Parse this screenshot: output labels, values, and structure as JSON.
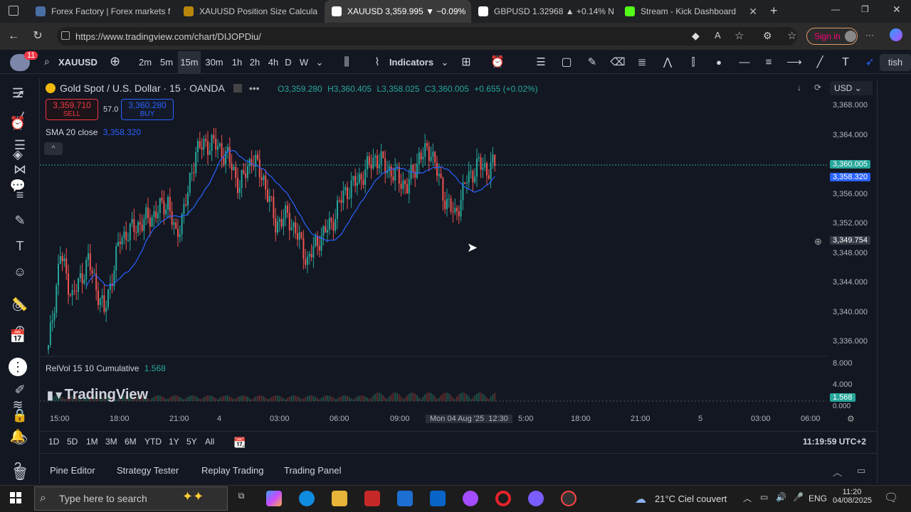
{
  "browser": {
    "tabs": [
      {
        "label": "Forex Factory | Forex markets f"
      },
      {
        "label": "XAUUSD Position Size Calcula"
      },
      {
        "label": "XAUUSD 3,359.995 ▼ −0.09%"
      },
      {
        "label": "GBPUSD 1.32968 ▲ +0.14% N"
      },
      {
        "label": "Stream - Kick Dashboard"
      }
    ],
    "url": "https://www.tradingview.com/chart/DIJOPDiu/",
    "signin": "Sign in"
  },
  "toolbar": {
    "notification_count": "11",
    "symbol": "XAUUSD",
    "intervals": [
      "2m",
      "5m",
      "15m",
      "30m",
      "1h",
      "2h",
      "4h",
      "D",
      "W"
    ],
    "selected_interval": "15m",
    "indicators": "Indicators",
    "publish": "tish"
  },
  "chart": {
    "title": "Gold Spot / U.S. Dollar · 15 · OANDA",
    "ohlc": {
      "o": "O3,359.280",
      "h": "H3,360.405",
      "l": "L3,358.025",
      "c": "C3,360.005",
      "chg": "+0.655 (+0.02%)"
    },
    "sell": {
      "price": "3,359.710",
      "label": "SELL"
    },
    "spread": "57.0",
    "buy": {
      "price": "3,360.280",
      "label": "BUY"
    },
    "sma_label": "SMA 20 close",
    "sma_value": "3,358.320",
    "currency": "USD",
    "relvol_label": "RelVol 15 10 Cumulative",
    "relvol_value": "1.568",
    "logo": "TradingView",
    "price_labels": [
      "3,368.000",
      "3,364.000",
      "3,360.005",
      "3,358.320",
      "3,356.000",
      "3,352.000",
      "3,349.754",
      "3,348.000",
      "3,344.000",
      "3,340.000",
      "3,336.000",
      "8.000",
      "4.000",
      "1.568",
      "0.000"
    ],
    "time_labels": [
      "15:00",
      "18:00",
      "21:00",
      "4",
      "03:00",
      "06:00",
      "09:00",
      "Mon 04 Aug '25",
      "12:30",
      "5:00",
      "18:00",
      "21:00",
      "5",
      "03:00",
      "06:00"
    ],
    "colors": {
      "up": "#26a69a",
      "down": "#ef5350",
      "sma": "#2962ff",
      "bg": "#131722"
    }
  },
  "ranges": [
    "1D",
    "5D",
    "1M",
    "3M",
    "6M",
    "YTD",
    "1Y",
    "5Y",
    "All"
  ],
  "clock": "11:19:59 UTC+2",
  "panels": [
    "Pine Editor",
    "Strategy Tester",
    "Replay Trading",
    "Trading Panel"
  ],
  "taskbar": {
    "search_placeholder": "Type here to search",
    "weather": "21°C  Ciel couvert",
    "lang": "ENG",
    "time": "11:20",
    "date": "04/08/2025"
  },
  "chart_data": {
    "type": "candlestick",
    "symbol": "XAUUSD",
    "interval": "15",
    "ylim": [
      3334,
      3370
    ],
    "last_close": 3360.005,
    "sma20_last": 3358.32,
    "cursor_price": 3349.754
  }
}
